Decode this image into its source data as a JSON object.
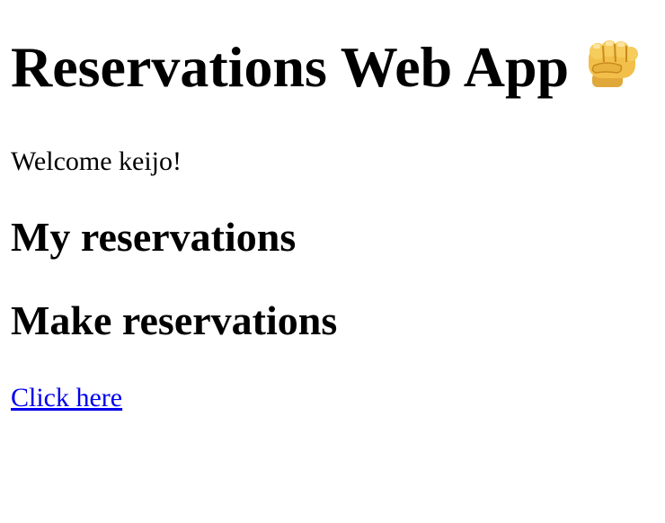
{
  "app": {
    "title": "Reservations Web App",
    "title_icon": "oncoming-fist-icon"
  },
  "welcome": {
    "text": "Welcome keijo!"
  },
  "sections": {
    "my_reservations": "My reservations",
    "make_reservations": "Make reservations"
  },
  "link": {
    "label": "Click here",
    "color": "#0000ee"
  },
  "colors": {
    "background": "#ffffff",
    "text": "#000000",
    "fist_skin": "#f2c04a",
    "fist_shadow": "#c98a1c"
  }
}
